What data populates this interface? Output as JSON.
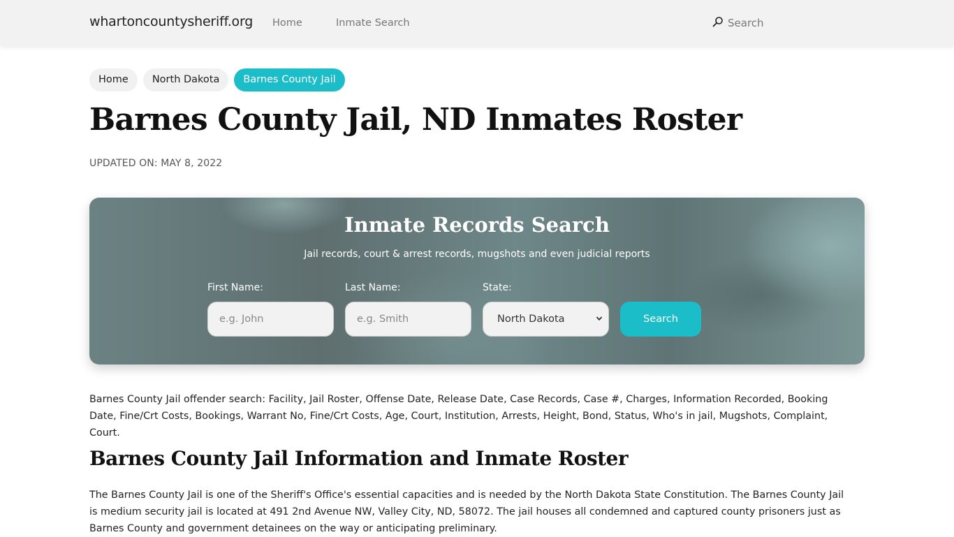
{
  "header": {
    "brand": "whartoncountysheriff.org",
    "nav": [
      {
        "label": "Home"
      },
      {
        "label": "Inmate Search"
      }
    ],
    "search_label": "Search",
    "search_icon": "search-icon"
  },
  "breadcrumb": [
    {
      "label": "Home",
      "active": false
    },
    {
      "label": "North Dakota",
      "active": false
    },
    {
      "label": "Barnes County Jail",
      "active": true
    }
  ],
  "page": {
    "title": "Barnes County Jail, ND Inmates Roster",
    "updated": "UPDATED ON: MAY 8, 2022"
  },
  "search_panel": {
    "title": "Inmate Records Search",
    "subtitle": "Jail records, court & arrest records, mugshots and even judicial reports",
    "first_name": {
      "label": "First Name:",
      "placeholder": "e.g. John",
      "value": ""
    },
    "last_name": {
      "label": "Last Name:",
      "placeholder": "e.g. Smith",
      "value": ""
    },
    "state": {
      "label": "State:",
      "selected": "North Dakota"
    },
    "button_label": "Search"
  },
  "content": {
    "description": "Barnes County Jail offender search: Facility, Jail Roster, Offense Date, Release Date, Case Records, Case #, Charges, Information Recorded, Booking Date, Fine/Crt Costs, Bookings, Warrant No, Fine/Crt Costs, Age, Court, Institution, Arrests, Height, Bond, Status, Who's in jail, Mugshots, Complaint, Court.",
    "section_title": "Barnes County Jail Information and Inmate Roster",
    "paragraph": "The Barnes County Jail is one of the Sheriff's Office's essential capacities and is needed by the North Dakota State Constitution. The Barnes County Jail is medium security jail is located at 491 2nd Avenue NW, Valley City, ND, 58072. The jail houses all condemned and captured county prisoners just as Barnes County and government detainees on the way or anticipating preliminary."
  },
  "colors": {
    "accent": "#1bbdc9",
    "header_bg": "#f2f2f2"
  }
}
